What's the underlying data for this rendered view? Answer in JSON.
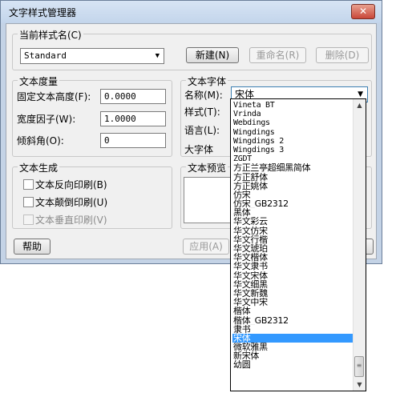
{
  "window": {
    "title": "文字样式管理器",
    "close_glyph": "✕"
  },
  "current_style": {
    "group_label": "当前样式名(C)",
    "value": "Standard",
    "new_button": "新建(N)",
    "rename_button": "重命名(R)",
    "delete_button": "删除(D)"
  },
  "text_metrics": {
    "group_label": "文本度量",
    "fixed_height_label": "固定文本高度(F):",
    "fixed_height_value": "0.0000",
    "width_factor_label": "宽度因子(W):",
    "width_factor_value": "1.0000",
    "oblique_label": "倾斜角(O):",
    "oblique_value": "0"
  },
  "text_font": {
    "group_label": "文本字体",
    "name_label": "名称(M):",
    "name_value": "宋体",
    "style_label": "样式(T):",
    "language_label": "语言(L):",
    "bigfont_label": "大字体"
  },
  "text_generation": {
    "group_label": "文本生成",
    "reverse_label": "文本反向印刷(B)",
    "upside_down_label": "文本颠倒印刷(U)",
    "vertical_label": "文本垂直印刷(V)"
  },
  "preview": {
    "group_label": "文本预览"
  },
  "bottom": {
    "help_button": "帮助",
    "apply_button": "应用(A)"
  },
  "font_list": {
    "items": [
      "Vineta BT",
      "Vrinda",
      "Webdings",
      "Wingdings",
      "Wingdings 2",
      "Wingdings 3",
      "ZGDT",
      "方正兰亭超细黑简体",
      "方正舒体",
      "方正姚体",
      "仿宋",
      "仿宋_GB2312",
      "黑体",
      "华文彩云",
      "华文仿宋",
      "华文行楷",
      "华文琥珀",
      "华文楷体",
      "华文隶书",
      "华文宋体",
      "华文细黑",
      "华文新魏",
      "华文中宋",
      "楷体",
      "楷体_GB2312",
      "隶书",
      "宋体",
      "微软雅黑",
      "新宋体",
      "幼圆"
    ],
    "selected": "宋体"
  },
  "icons": {
    "scroll_up": "▲",
    "scroll_down": "▼",
    "combo_arrow": "▼",
    "grip": "≡"
  }
}
